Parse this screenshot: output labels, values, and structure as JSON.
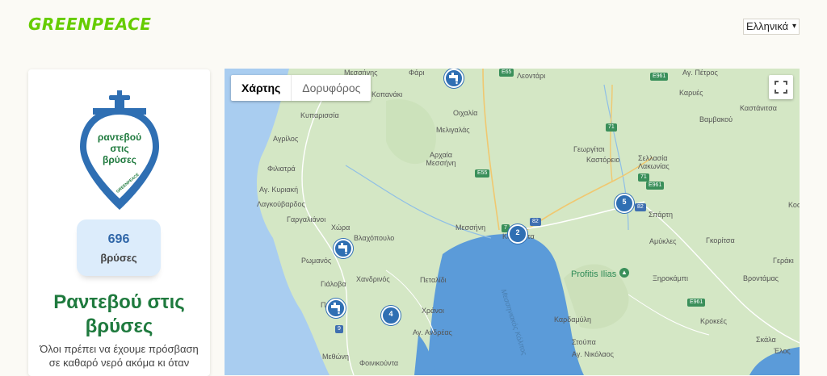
{
  "header": {
    "logo_text": "GREENPEACE",
    "language": "Ελληνικά"
  },
  "sidebar": {
    "badge_lines": [
      "ραντεβού",
      "στις",
      "βρύσες"
    ],
    "badge_brand": "GREENPEACE",
    "count_value": "696",
    "count_label": "βρύσες",
    "title": "Ραντεβού στις βρύσες",
    "description": "Όλοι πρέπει να έχουμε πρόσβαση σε καθαρό νερό ακόμα κι όταν"
  },
  "map": {
    "tabs": [
      "Χάρτης",
      "Δορυφόρος"
    ],
    "active_tab": "Χάρτης",
    "fullscreen_icon": "fullscreen-icon",
    "sea_label": "Μεσσηνιακός Κόλπος",
    "park_label": "Profitis Ilias",
    "places": [
      "Μεσσήνης",
      "Φάρι",
      "Λεοντάρι",
      "Αγ. Πέτρος",
      "Κοπανάκι",
      "Κυπαρισσία",
      "Οιχαλία",
      "Καρυές",
      "Καστάνιτσα",
      "Μελιγαλάς",
      "Βαμβακού",
      "Αγρίλος",
      "Αρχαία Μεσσήνη",
      "Γεωργίτσι",
      "Καστόρειο",
      "Σελλασία Λακωνίας",
      "Φιλιατρά",
      "Αγ. Κυριακή",
      "Λαγκούβαρδος",
      "Σπάρτη",
      "Γαργαλιάνοι",
      "Χώρα",
      "Βλαχόπουλο",
      "Μεσσήνη",
      "Καλαμάτα",
      "Αμύκλες",
      "Γκορίτσα",
      "Κοσ",
      "Ρωμανός",
      "Γεράκι",
      "Ξηροκάμπι",
      "Βροντάμας",
      "Γιάλοβα",
      "Χανδρινός",
      "Πεταλίδι",
      "Πύλος",
      "Χράνοι",
      "Καρδαμύλη",
      "Κροκεές",
      "Αγ. Ανδρέας",
      "Στούπα",
      "Σκάλα",
      "Αγ. Νικόλαος",
      "Μεθώνη",
      "Φοινικούντα",
      "Έλος"
    ],
    "route_shields": [
      "E55",
      "E961",
      "71",
      "82",
      "7",
      "9",
      "E65"
    ],
    "markers": [
      "tap",
      "tap",
      "tap",
      "tap",
      "2",
      "5",
      "4"
    ]
  },
  "colors": {
    "brand_green": "#66cc00",
    "title_green": "#1f7a3e",
    "marker_blue": "#2f6fb3",
    "count_bg": "#dcecfb",
    "sea": "#5b9bd9",
    "land": "#d4e7c5"
  }
}
